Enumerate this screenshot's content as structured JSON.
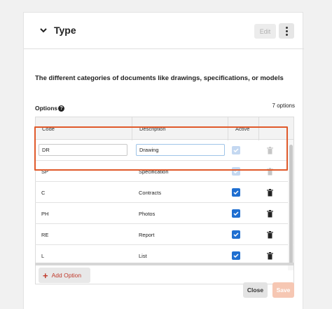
{
  "section": {
    "title": "Type",
    "edit_label": "Edit",
    "description": "The different categories of documents like drawings, specifications, or models"
  },
  "options": {
    "label": "Options",
    "count_text": "7 options",
    "columns": {
      "code": "Code",
      "description": "Description",
      "active": "Active"
    },
    "rows": [
      {
        "code": "DR",
        "description": "Drawing",
        "active": true,
        "editable": true
      },
      {
        "code": "SP",
        "description": "Specification",
        "active": true,
        "editable": false
      },
      {
        "code": "C",
        "description": "Contracts",
        "active": true
      },
      {
        "code": "PH",
        "description": "Photos",
        "active": true
      },
      {
        "code": "RE",
        "description": "Report",
        "active": true
      },
      {
        "code": "L",
        "description": "List",
        "active": true
      }
    ],
    "add_label": "Add Option"
  },
  "footer": {
    "close_label": "Close",
    "save_label": "Save"
  },
  "colors": {
    "accent": "#e05a2b",
    "checkbox": "#1f6fd1",
    "add_text": "#c0392b"
  }
}
